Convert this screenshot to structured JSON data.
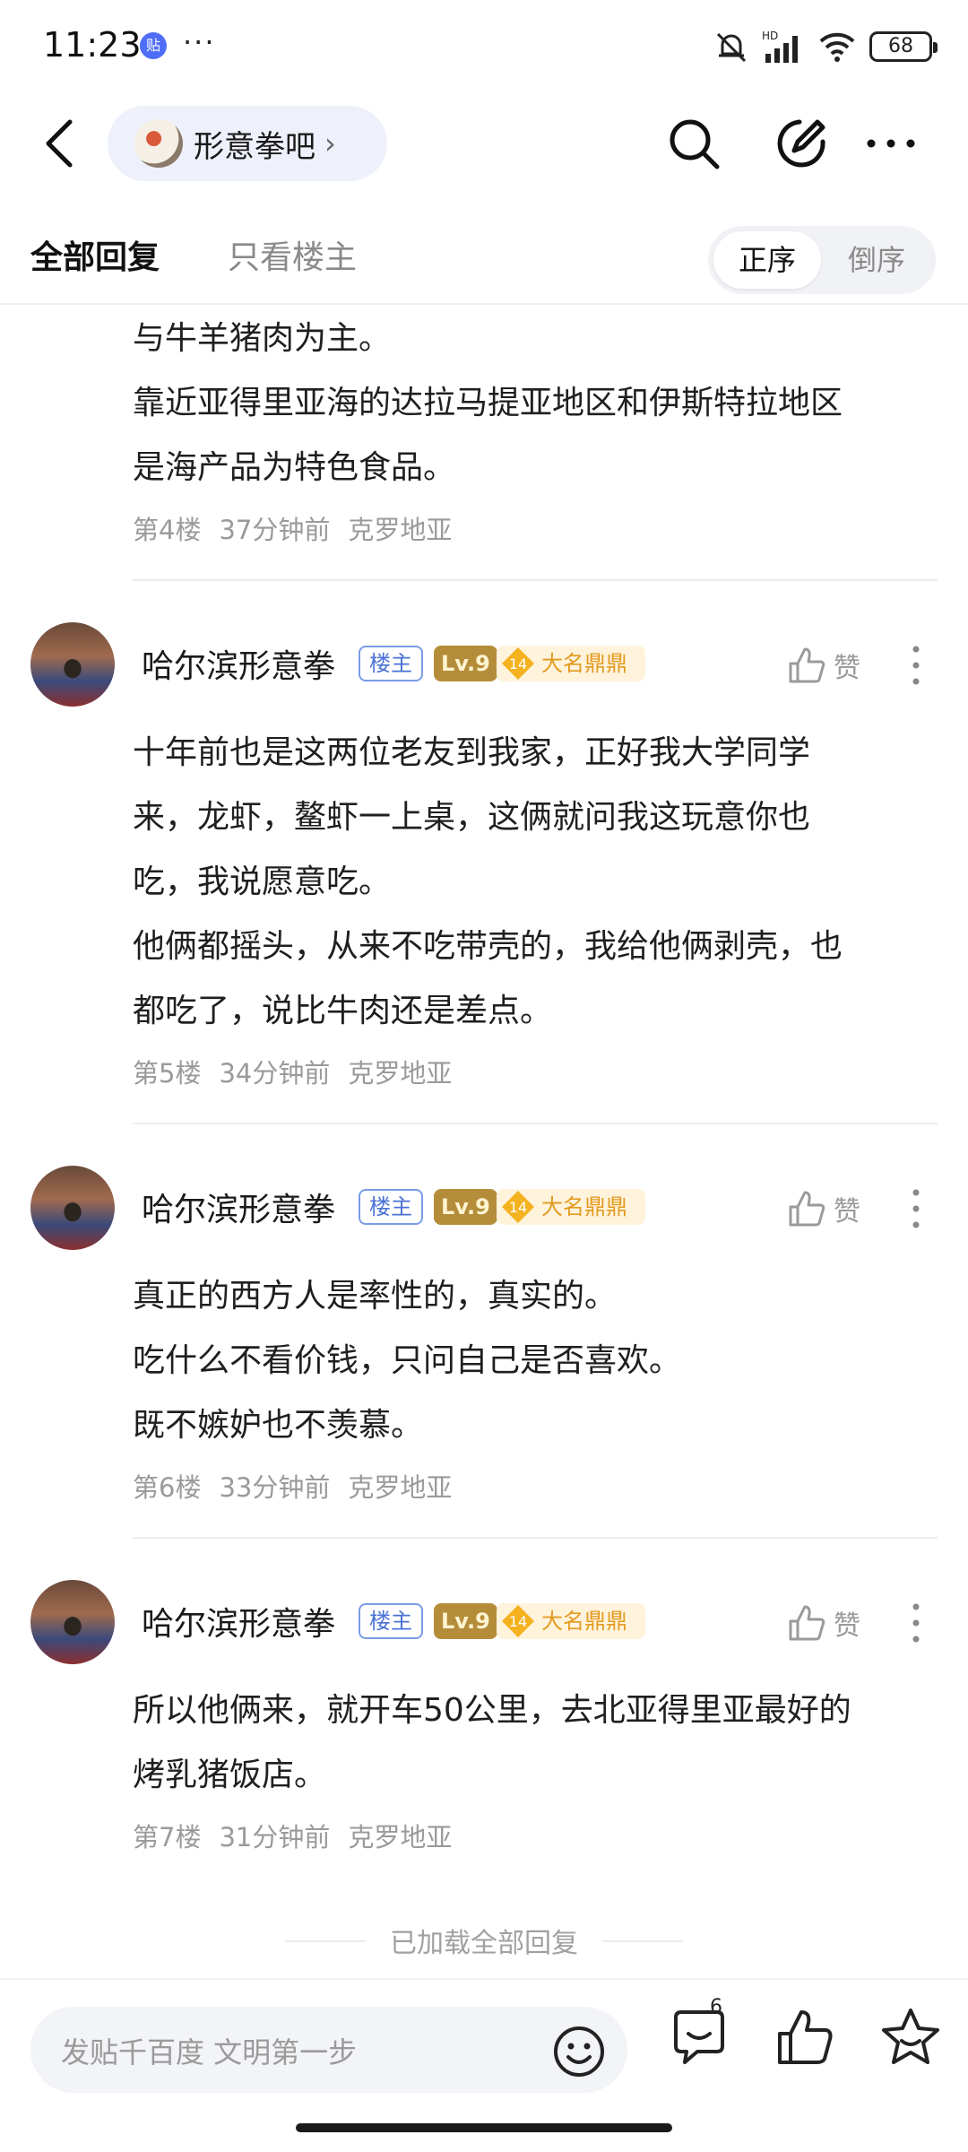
{
  "status_bar": {
    "time": "11:23",
    "app_badge": "贴",
    "more": "···",
    "battery": "68",
    "network": "HD"
  },
  "header": {
    "forum_name": "形意拳吧",
    "chevron": "›"
  },
  "tabs": {
    "all_replies": "全部回复",
    "only_op": "只看楼主"
  },
  "order": {
    "ascending": "正序",
    "descending": "倒序"
  },
  "top_partial": {
    "lines": [
      "与牛羊猪肉为主。",
      "靠近亚得里亚海的达拉马提亚地区和伊斯特拉地区",
      "是海产品为特色食品。"
    ],
    "floor": "第4楼",
    "time": "37分钟前",
    "location": "克罗地亚"
  },
  "replies": [
    {
      "username": "哈尔滨形意拳",
      "op_badge": "楼主",
      "level": "Lv.9",
      "title_level": "14",
      "title": "大名鼎鼎",
      "like_label": "赞",
      "lines": [
        "十年前也是这两位老友到我家，正好我大学同学",
        "来，龙虾，鳌虾一上桌，这俩就问我这玩意你也",
        "吃，我说愿意吃。",
        "他俩都摇头，从来不吃带壳的，我给他俩剥壳，也",
        "都吃了，说比牛肉还是差点。"
      ],
      "floor": "第5楼",
      "time": "34分钟前",
      "location": "克罗地亚"
    },
    {
      "username": "哈尔滨形意拳",
      "op_badge": "楼主",
      "level": "Lv.9",
      "title_level": "14",
      "title": "大名鼎鼎",
      "like_label": "赞",
      "lines": [
        "真正的西方人是率性的，真实的。",
        "吃什么不看价钱，只问自己是否喜欢。",
        "既不嫉妒也不羡慕。"
      ],
      "floor": "第6楼",
      "time": "33分钟前",
      "location": "克罗地亚"
    },
    {
      "username": "哈尔滨形意拳",
      "op_badge": "楼主",
      "level": "Lv.9",
      "title_level": "14",
      "title": "大名鼎鼎",
      "like_label": "赞",
      "lines": [
        "所以他俩来，就开车50公里，去北亚得里亚最好的",
        "烤乳猪饭店。"
      ],
      "floor": "第7楼",
      "time": "31分钟前",
      "location": "克罗地亚"
    }
  ],
  "loaded_all": "已加载全部回复",
  "bottom_bar": {
    "placeholder": "发贴千百度 文明第一步",
    "reply_count": "6"
  }
}
